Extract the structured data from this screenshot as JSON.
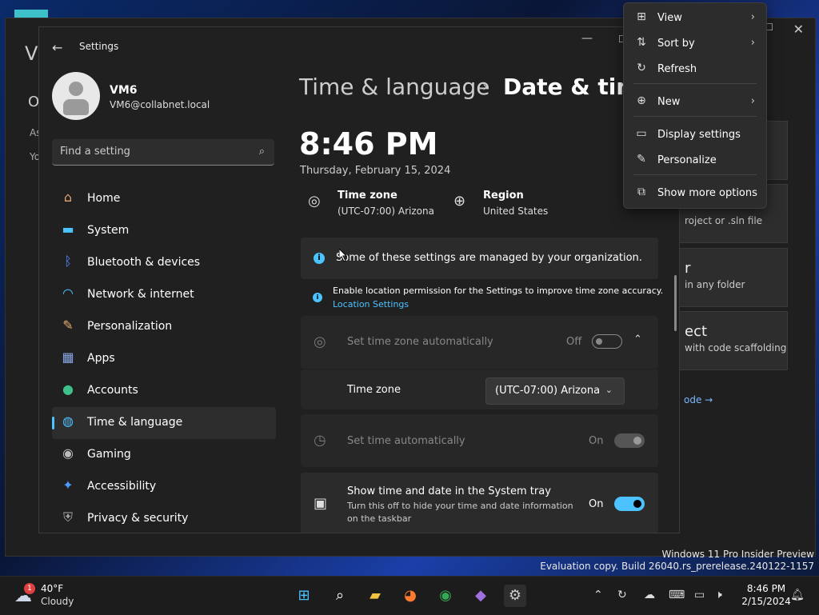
{
  "background_window": {
    "title_fragment": "Vi",
    "heading_fragment": "O",
    "line1": "As",
    "line2": "Yo",
    "cards": [
      {
        "title": "",
        "subtitle": ""
      },
      {
        "title": "",
        "subtitle": "roject or .sln file"
      },
      {
        "title": "r",
        "subtitle": "in any folder"
      },
      {
        "title": "ect",
        "subtitle": "with code scaffolding"
      }
    ],
    "link": "ode →",
    "watermark_line1": "Windows 11 Pro Insider Preview",
    "watermark_line2": "Evaluation copy. Build 26040.rs_prerelease.240122-1157"
  },
  "settings": {
    "app_title": "Settings",
    "user": {
      "name": "VM6",
      "email": "VM6@collabnet.local"
    },
    "search": {
      "placeholder": "Find a setting"
    },
    "nav": [
      {
        "label": "Home",
        "icon": "home-icon",
        "glyph": "⌂",
        "color": "#e8a070"
      },
      {
        "label": "System",
        "icon": "system-icon",
        "glyph": "▬",
        "color": "#4cc2ff"
      },
      {
        "label": "Bluetooth & devices",
        "icon": "bluetooth-icon",
        "glyph": "ᛒ",
        "color": "#4c8cff"
      },
      {
        "label": "Network & internet",
        "icon": "wifi-icon",
        "glyph": "◠",
        "color": "#4cc2ff"
      },
      {
        "label": "Personalization",
        "icon": "brush-icon",
        "glyph": "✎",
        "color": "#e8b070"
      },
      {
        "label": "Apps",
        "icon": "apps-icon",
        "glyph": "▦",
        "color": "#8aa8e8"
      },
      {
        "label": "Accounts",
        "icon": "accounts-icon",
        "glyph": "●",
        "color": "#3ec08a"
      },
      {
        "label": "Time & language",
        "icon": "globe-clock-icon",
        "glyph": "◍",
        "color": "#4cc2ff",
        "selected": true
      },
      {
        "label": "Gaming",
        "icon": "gamepad-icon",
        "glyph": "◉",
        "color": "#bbbbbb"
      },
      {
        "label": "Accessibility",
        "icon": "accessibility-icon",
        "glyph": "✦",
        "color": "#4c9cff"
      },
      {
        "label": "Privacy & security",
        "icon": "shield-icon",
        "glyph": "⛨",
        "color": "#aaaaaa"
      }
    ],
    "breadcrumb": {
      "parent": "Time & language",
      "separator": "›",
      "current": "Date & time"
    },
    "clock": {
      "time": "8:46 PM",
      "date": "Thursday, February 15, 2024"
    },
    "time_zone_info": {
      "label": "Time zone",
      "value": "(UTC-07:00) Arizona"
    },
    "region_info": {
      "label": "Region",
      "value": "United States"
    },
    "managed_notice": "Some of these settings are managed by your organization.",
    "location_notice": {
      "text": "Enable location permission for the Settings to improve time zone accuracy.",
      "link": "Location Settings"
    },
    "set_tz_auto": {
      "label": "Set time zone automatically",
      "state": "Off"
    },
    "time_zone_row": {
      "label": "Time zone",
      "value": "(UTC-07:00) Arizona"
    },
    "set_time_auto": {
      "label": "Set time automatically",
      "state": "On"
    },
    "show_tray": {
      "label": "Show time and date in the System tray",
      "description_line1": "Turn this off to hide your time and date information",
      "description_line2": "on the taskbar",
      "state": "On"
    }
  },
  "context_menu": {
    "items": [
      {
        "label": "View",
        "icon": "grid-icon",
        "glyph": "⊞",
        "submenu": true
      },
      {
        "label": "Sort by",
        "icon": "sort-icon",
        "glyph": "⇅",
        "submenu": true
      },
      {
        "label": "Refresh",
        "icon": "refresh-icon",
        "glyph": "↻",
        "submenu": false
      },
      {
        "label": "New",
        "icon": "plus-circle-icon",
        "glyph": "⊕",
        "submenu": true
      },
      {
        "label": "Display settings",
        "icon": "display-icon",
        "glyph": "▭",
        "submenu": false
      },
      {
        "label": "Personalize",
        "icon": "pen-icon",
        "glyph": "✎",
        "submenu": false
      },
      {
        "label": "Show more options",
        "icon": "expand-icon",
        "glyph": "⧉",
        "submenu": false
      }
    ]
  },
  "taskbar": {
    "weather": {
      "temp": "40°F",
      "condition": "Cloudy",
      "badge": "1"
    },
    "apps": [
      {
        "name": "start-button",
        "glyph": "⊞",
        "color": "#4cc2ff"
      },
      {
        "name": "search-button",
        "glyph": "⌕",
        "color": "#ffffff"
      },
      {
        "name": "file-explorer-button",
        "glyph": "▰",
        "color": "#f2c440"
      },
      {
        "name": "firefox-button",
        "glyph": "◕",
        "color": "#ff7b2e"
      },
      {
        "name": "chrome-button",
        "glyph": "◉",
        "color": "#34a853"
      },
      {
        "name": "visual-studio-button",
        "glyph": "◆",
        "color": "#a070e0"
      },
      {
        "name": "settings-button",
        "glyph": "⚙",
        "color": "#cccccc"
      }
    ],
    "clock": {
      "time": "8:46 PM",
      "date": "2/15/2024"
    }
  }
}
